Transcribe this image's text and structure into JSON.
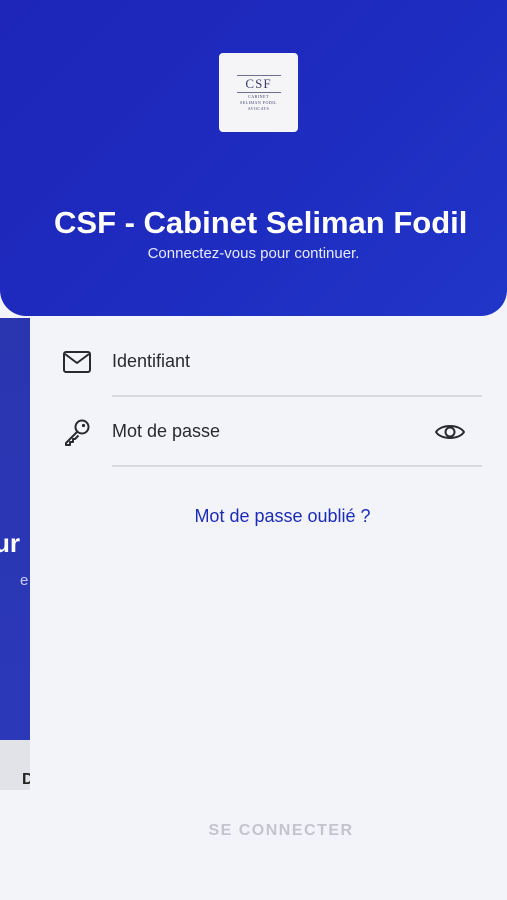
{
  "header": {
    "logo": {
      "mark": "CSF",
      "line1": "CABINET",
      "line2": "SELIMAN FODIL",
      "line3": "AVOCATS"
    },
    "title": "CSF - Cabinet Seliman Fodil",
    "subtitle": "Connectez-vous pour continuer."
  },
  "form": {
    "identifier": {
      "label": "Identifiant",
      "icon": "mail-icon"
    },
    "password": {
      "label": "Mot de passe",
      "icon": "key-icon",
      "toggle_icon": "eye-icon"
    },
    "forgot_password": "Mot de passe oublié ?",
    "submit": "SE CONNECTER"
  },
  "background_page": {
    "title_fragment": "ur",
    "subtitle_fragment": "e",
    "footer_fragment": "D"
  },
  "colors": {
    "header_blue": "#1e2cc0",
    "link_blue": "#1d2cb8",
    "background": "#f3f4f9",
    "disabled_text": "#c4c5cc"
  }
}
